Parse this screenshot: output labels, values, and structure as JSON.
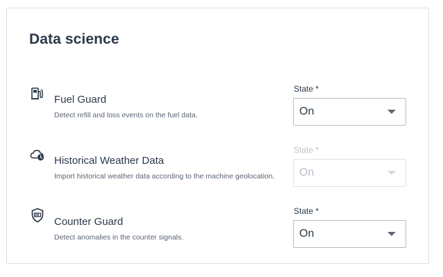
{
  "section": {
    "title": "Data science"
  },
  "services": [
    {
      "title": "Fuel Guard",
      "description": "Detect refill and loss events on the fuel data.",
      "icon": "fuel-pump-icon",
      "state_label": "State *",
      "state_value": "On",
      "disabled": false
    },
    {
      "title": "Historical Weather Data",
      "description": "Import historical weather data according to the machine geolocation.",
      "icon": "cloud-clock-icon",
      "state_label": "State *",
      "state_value": "On",
      "disabled": true
    },
    {
      "title": "Counter Guard",
      "description": "Detect anomalies in the counter signals.",
      "icon": "shield-counter-icon",
      "state_label": "State *",
      "state_value": "On",
      "disabled": false
    }
  ],
  "colors": {
    "text_primary": "#2b3848",
    "text_secondary": "#5a6472",
    "disabled_text": "#b9bfc7",
    "border": "#b7bcc4"
  }
}
